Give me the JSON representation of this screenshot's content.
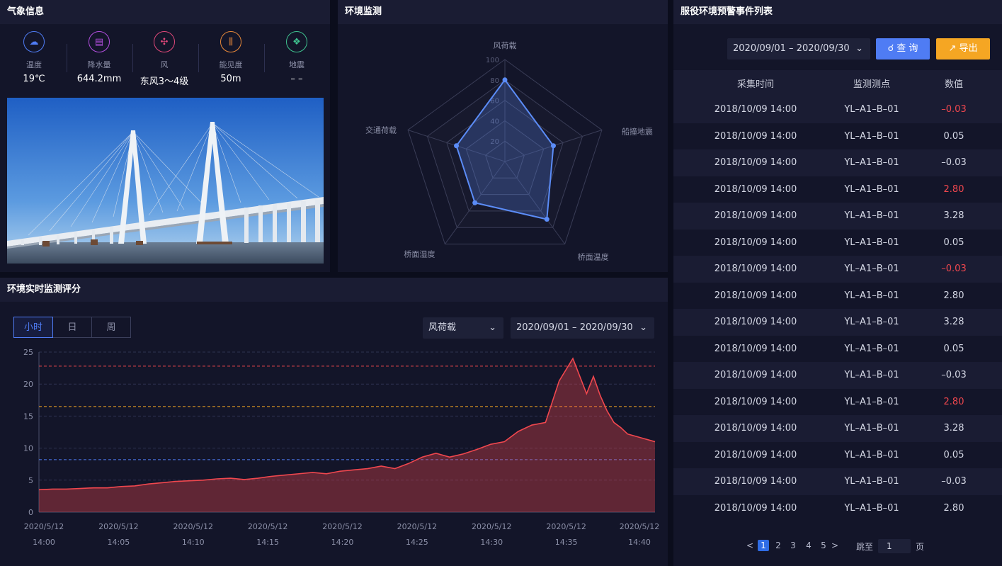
{
  "weather": {
    "title": "气象信息",
    "items": [
      {
        "label": "温度",
        "value": "19℃",
        "icon": "cloud-sun-icon",
        "color": "#4f7cf4",
        "glyph": "☁"
      },
      {
        "label": "降水量",
        "value": "644.2mm",
        "icon": "rain-gauge-icon",
        "color": "#b44fe0",
        "glyph": "▤"
      },
      {
        "label": "风",
        "value": "东风3～4级",
        "icon": "fan-icon",
        "color": "#e0487a",
        "glyph": "✣"
      },
      {
        "label": "能见度",
        "value": "50m",
        "icon": "visibility-bars-icon",
        "color": "#e8893a",
        "glyph": "⫼"
      },
      {
        "label": "地震",
        "value": "– –",
        "icon": "earthquake-icon",
        "color": "#3fc28f",
        "glyph": "❖"
      }
    ]
  },
  "radar": {
    "title": "环境监测",
    "axes": [
      "风荷载",
      "船撞地震",
      "桥面温度",
      "桥面湿度",
      "交通荷载"
    ],
    "ticks": [
      "20",
      "40",
      "60",
      "80",
      "100"
    ],
    "values": [
      80,
      50,
      70,
      50,
      50
    ],
    "color": "#5b8cf7"
  },
  "events": {
    "title": "服役环境预警事件列表",
    "date_range": "2020/09/01 – 2020/09/30",
    "query_label": "查 询",
    "export_label": "导出",
    "columns": [
      "采集时间",
      "监测测点",
      "数值"
    ],
    "rows": [
      {
        "time": "2018/10/09 14:00",
        "point": "YL–A1–B–01",
        "value": "–0.03",
        "alert": true
      },
      {
        "time": "2018/10/09 14:00",
        "point": "YL–A1–B–01",
        "value": "0.05",
        "alert": false
      },
      {
        "time": "2018/10/09 14:00",
        "point": "YL–A1–B–01",
        "value": "–0.03",
        "alert": false
      },
      {
        "time": "2018/10/09 14:00",
        "point": "YL–A1–B–01",
        "value": "2.80",
        "alert": true
      },
      {
        "time": "2018/10/09 14:00",
        "point": "YL–A1–B–01",
        "value": "3.28",
        "alert": false
      },
      {
        "time": "2018/10/09 14:00",
        "point": "YL–A1–B–01",
        "value": "0.05",
        "alert": false
      },
      {
        "time": "2018/10/09 14:00",
        "point": "YL–A1–B–01",
        "value": "–0.03",
        "alert": true
      },
      {
        "time": "2018/10/09 14:00",
        "point": "YL–A1–B–01",
        "value": "2.80",
        "alert": false
      },
      {
        "time": "2018/10/09 14:00",
        "point": "YL–A1–B–01",
        "value": "3.28",
        "alert": false
      },
      {
        "time": "2018/10/09 14:00",
        "point": "YL–A1–B–01",
        "value": "0.05",
        "alert": false
      },
      {
        "time": "2018/10/09 14:00",
        "point": "YL–A1–B–01",
        "value": "–0.03",
        "alert": false
      },
      {
        "time": "2018/10/09 14:00",
        "point": "YL–A1–B–01",
        "value": "2.80",
        "alert": true
      },
      {
        "time": "2018/10/09 14:00",
        "point": "YL–A1–B–01",
        "value": "3.28",
        "alert": false
      },
      {
        "time": "2018/10/09 14:00",
        "point": "YL–A1–B–01",
        "value": "0.05",
        "alert": false
      },
      {
        "time": "2018/10/09 14:00",
        "point": "YL–A1–B–01",
        "value": "–0.03",
        "alert": false
      },
      {
        "time": "2018/10/09 14:00",
        "point": "YL–A1–B–01",
        "value": "2.80",
        "alert": false
      }
    ],
    "pager": {
      "prev": "<",
      "next": ">",
      "pages": [
        "1",
        "2",
        "3",
        "4",
        "5"
      ],
      "current": "1",
      "jump_label": "跳至",
      "jump_value": "1",
      "page_suffix": "页"
    }
  },
  "score": {
    "title": "环境实时监测评分",
    "tabs": [
      "小时",
      "日",
      "周"
    ],
    "active_tab": "小时",
    "metric_select": "风荷载",
    "date_range": "2020/09/01 – 2020/09/30"
  },
  "chart_data": {
    "type": "area",
    "color": "#f0474e",
    "ylim": [
      0,
      25
    ],
    "yticks": [
      "0",
      "5",
      "10",
      "15",
      "20",
      "25"
    ],
    "xticks": [
      [
        "2020/5/12",
        "14:00"
      ],
      [
        "2020/5/12",
        "14:05"
      ],
      [
        "2020/5/12",
        "14:10"
      ],
      [
        "2020/5/12",
        "14:15"
      ],
      [
        "2020/5/12",
        "14:20"
      ],
      [
        "2020/5/12",
        "14:25"
      ],
      [
        "2020/5/12",
        "14:30"
      ],
      [
        "2020/5/12",
        "14:35"
      ],
      [
        "2020/5/12",
        "14:40"
      ]
    ],
    "threshold_lines": [
      {
        "value": 22.8,
        "color": "#f0474e"
      },
      {
        "value": 16.5,
        "color": "#f5a623"
      },
      {
        "value": 8.2,
        "color": "#4f7cf4"
      }
    ],
    "x": [
      0,
      1,
      2,
      3,
      4,
      5,
      6,
      7,
      8,
      9,
      10,
      11,
      12,
      13,
      14,
      15,
      16,
      17,
      18,
      19,
      20,
      21,
      22,
      23,
      24,
      25,
      26,
      27,
      28,
      29,
      30,
      31,
      32,
      33,
      34,
      35,
      36,
      37,
      38,
      39,
      40,
      40.5,
      41,
      41.5,
      42,
      42.5,
      43,
      44,
      45
    ],
    "values": [
      3.5,
      3.6,
      3.6,
      3.7,
      3.8,
      3.8,
      4.0,
      4.1,
      4.4,
      4.6,
      4.8,
      4.9,
      5.0,
      5.2,
      5.3,
      5.1,
      5.3,
      5.6,
      5.8,
      6.0,
      6.2,
      6.0,
      6.4,
      6.6,
      6.8,
      7.2,
      6.8,
      7.6,
      8.6,
      9.2,
      8.6,
      9.1,
      9.8,
      10.6,
      11.0,
      12.6,
      13.6,
      14.0,
      20.5,
      24.0,
      18.5,
      21.2,
      18.2,
      15.8,
      14.0,
      13.2,
      12.2,
      11.6,
      11.0
    ]
  }
}
